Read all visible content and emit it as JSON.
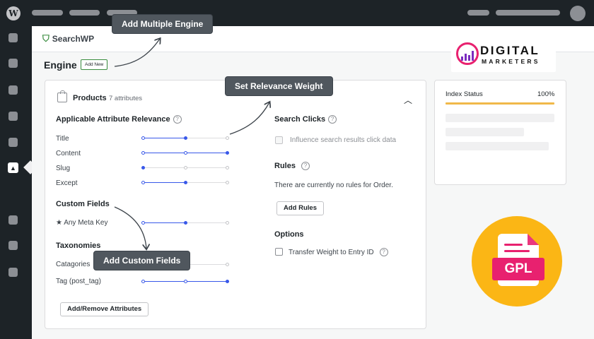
{
  "brand": {
    "name": "SearchWP"
  },
  "engine": {
    "title": "Engine",
    "add_new": "Add New"
  },
  "products": {
    "label": "Products",
    "attr_count": "7 attributes"
  },
  "relevance": {
    "title": "Applicable Attribute Relevance",
    "rows": [
      {
        "label": "Title",
        "weight": 0.5
      },
      {
        "label": "Content",
        "weight": 1.0
      },
      {
        "label": "Slug",
        "weight": 0.0
      },
      {
        "label": "Except",
        "weight": 0.5
      }
    ]
  },
  "custom_fields": {
    "title": "Custom Fields",
    "rows": [
      {
        "label": "★ Any Meta Key",
        "weight": 0.5
      }
    ]
  },
  "taxonomies": {
    "title": "Taxonomies",
    "rows": [
      {
        "label": "Catagories",
        "weight": 0.5
      },
      {
        "label": "Tag (post_tag)",
        "weight": 1.0
      }
    ]
  },
  "add_remove_button": "Add/Remove Attributes",
  "search_clicks": {
    "title": "Search Clicks",
    "checkbox_label": "Influence search results click data"
  },
  "rules": {
    "title": "Rules",
    "empty_text": "There are currently no rules for Order.",
    "add_button": "Add Rules"
  },
  "options": {
    "title": "Options",
    "checkbox_label": "Transfer Weight to Entry ID"
  },
  "index_status": {
    "label": "Index Status",
    "percent": "100%",
    "progress": 1.0
  },
  "callouts": {
    "multiple_engine": "Add Multiple Engine",
    "relevance_weight": "Set Relevance Weight",
    "custom_fields": "Add Custom Fields"
  },
  "watermark": {
    "title": "DIGITAL",
    "subtitle": "MARKETERS"
  },
  "badge": {
    "text": "GPL"
  },
  "icons": {
    "wp_logo": "wordpress-icon",
    "brand": "searchwp-leaf-icon",
    "products": "shopping-bag-icon",
    "collapse": "chevron-up-icon",
    "help": "question-circle-icon"
  },
  "colors": {
    "admin_bar": "#1d2327",
    "slider": "#3858e9",
    "brand_green": "#3a8d3f",
    "status_bar": "#f0b849",
    "gpl_circle": "#fbb615",
    "gpl_accent": "#e8216f"
  }
}
